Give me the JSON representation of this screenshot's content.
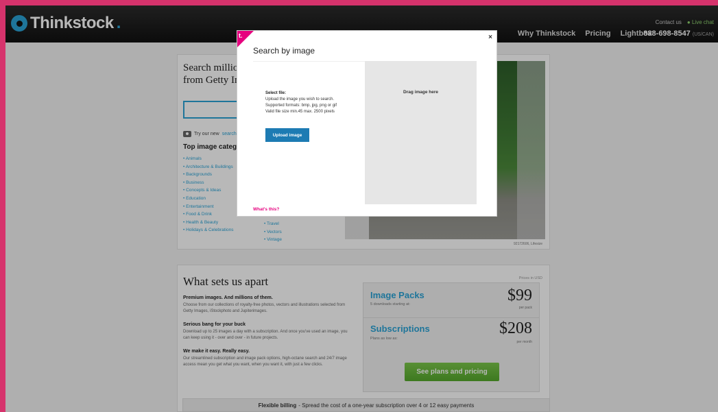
{
  "header": {
    "logo_text": "Thinkstock",
    "nav": [
      "Why Thinkstock",
      "Pricing",
      "Lightbox"
    ],
    "contact_label": "Contact us",
    "live_chat": "Live chat",
    "phone": "888-698-8547",
    "phone_region": "(US/CAN)"
  },
  "search_panel": {
    "title": "Search millions of royalty-free images from Getty Images, iStockphoto",
    "try_prefix": "Try our new",
    "try_link": "search",
    "categories_title": "Top image categories",
    "categories": [
      "Animals",
      "Architecture & Buildings",
      "Backgrounds",
      "Business",
      "Concepts & Ideas",
      "Education",
      "Entertainment",
      "Food & Drink",
      "Health & Beauty",
      "Holidays & Celebrations"
    ],
    "categories_col2": [
      "Travel",
      "Vectors",
      "Vintage"
    ],
    "photo_credit": "92172606, Lifesize"
  },
  "apart_panel": {
    "title": "What sets us apart",
    "blocks": [
      {
        "heading": "Premium images. And millions of them.",
        "text": "Choose from our collections of royalty-free photos, vectors and illustrations selected from Getty Images, iStockphoto and Jupiterimages."
      },
      {
        "heading": "Serious bang for your buck",
        "text": "Download up to 25 images a day with a subscription. And once you've used an image, you can keep using it - over and over - in future projects."
      },
      {
        "heading": "We make it easy. Really easy.",
        "text": "Our streamlined subscription and image pack options, high-octane search and 24/7 image access mean you get what you want, when you want it, with just a few clicks."
      }
    ],
    "prices_note": "Prices in USD",
    "image_packs": {
      "name": "Image Packs",
      "sub": "5 downloads starting at:",
      "price": "$99",
      "unit": "per pack"
    },
    "subscriptions": {
      "name": "Subscriptions",
      "sub": "Plans as low as:",
      "price": "$208",
      "unit": "per month"
    },
    "plans_button": "See plans and pricing"
  },
  "billing": {
    "bold": "Flexible billing",
    "text": "- Spread the cost of a one-year subscription over 4 or 12 easy payments"
  },
  "modal": {
    "corner_logo": "t.",
    "close": "×",
    "title": "Search by image",
    "select_file": "Select file:",
    "instructions": [
      "Upload the image you wish to search.",
      "Supported formats: bmp, jpg, png or gif",
      "Valid file size min.45 max. 2500 pixels"
    ],
    "upload_button": "Upload image",
    "drop_label": "Drag image here",
    "whats_this": "What's this?"
  }
}
